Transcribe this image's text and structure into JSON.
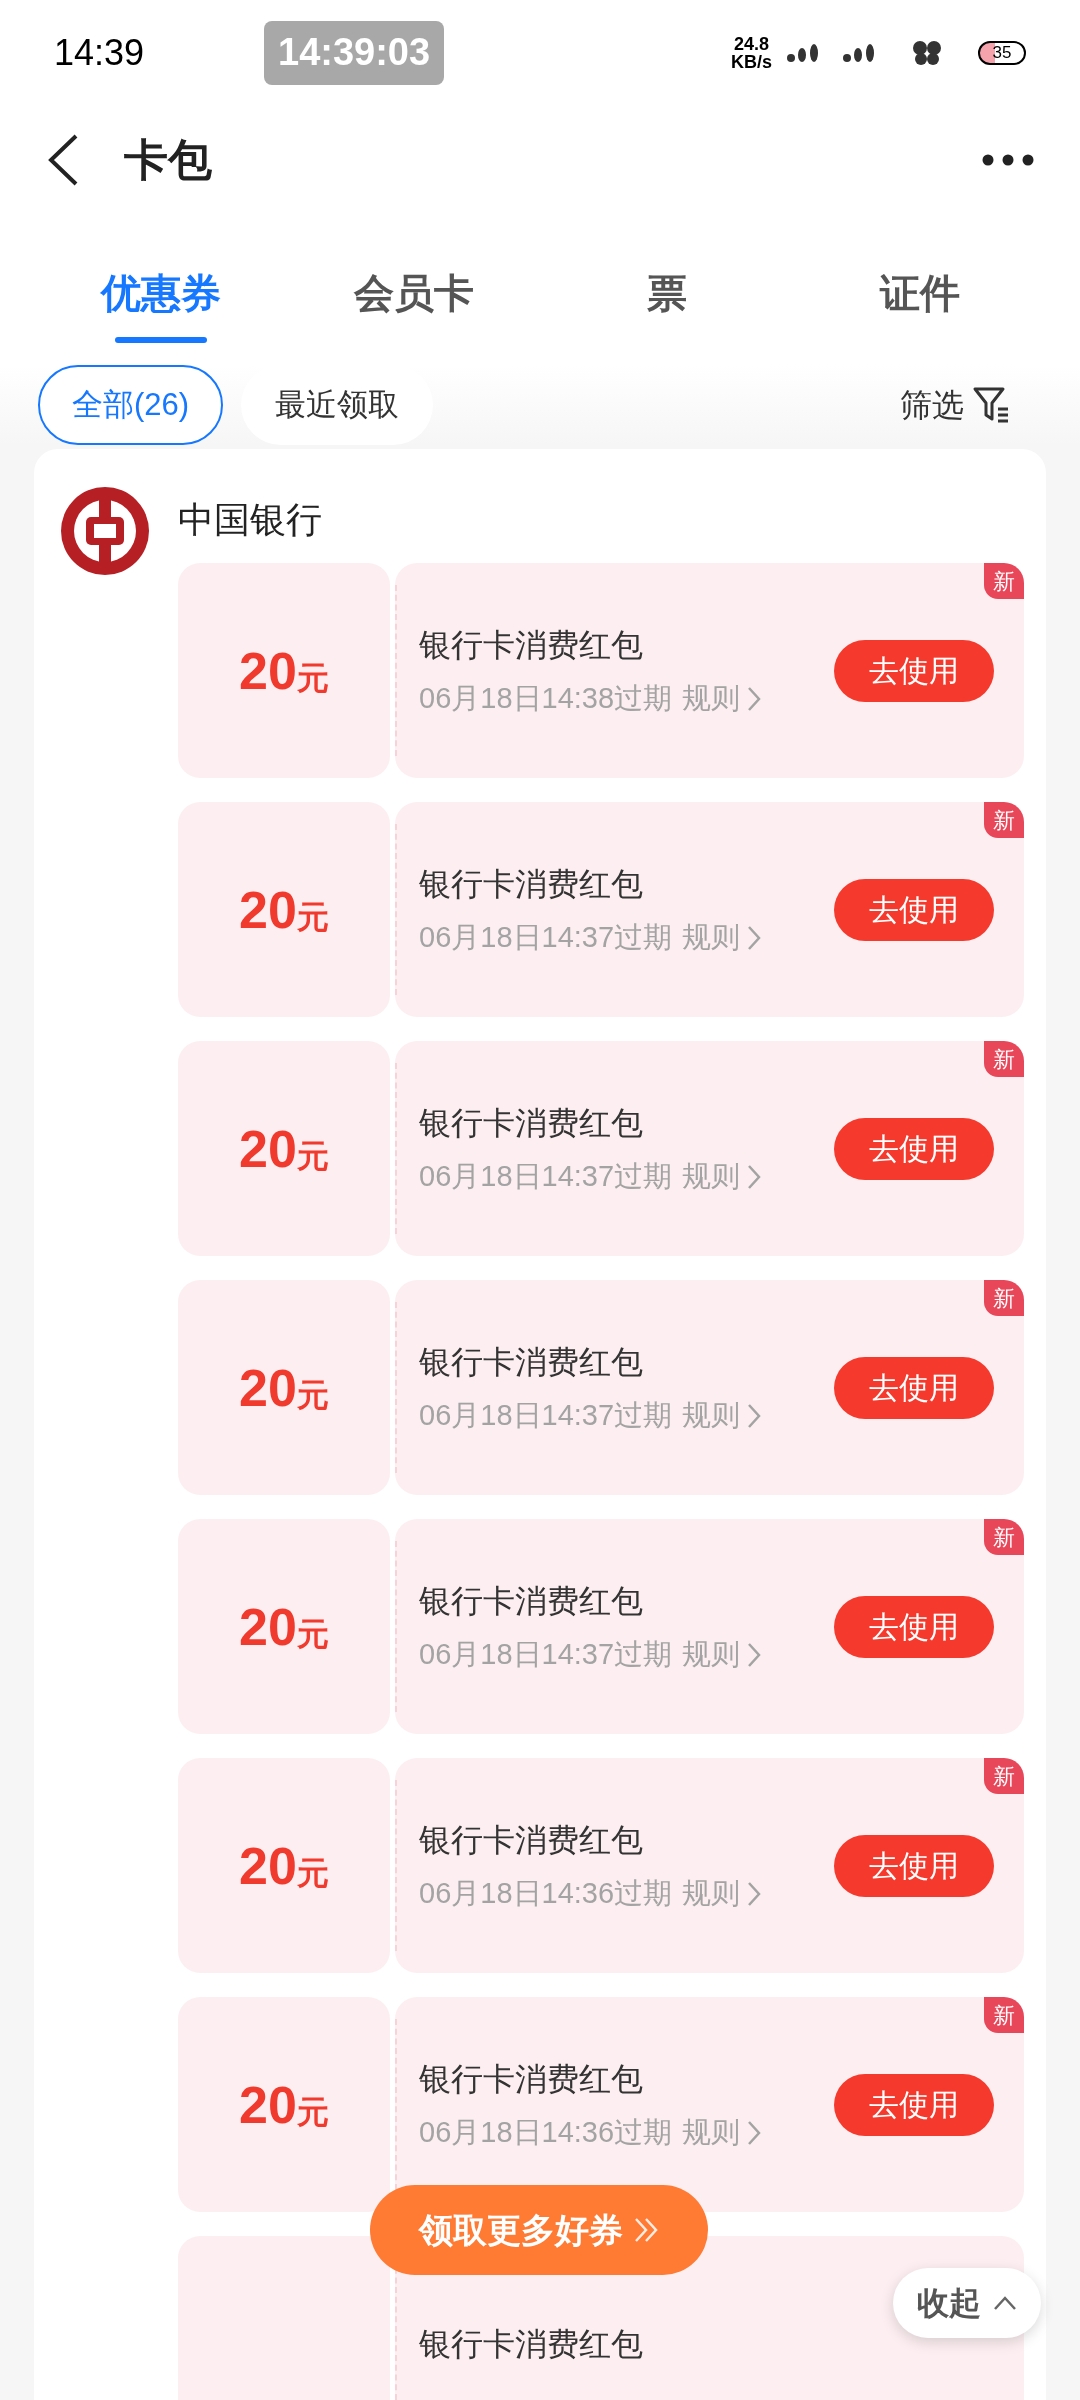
{
  "status_bar": {
    "time": "14:39",
    "recorder_clock": "14:39:03",
    "net_speed": "24.8",
    "net_unit": "KB/s",
    "battery": "35"
  },
  "header": {
    "title": "卡包"
  },
  "tabs": [
    {
      "label": "优惠券",
      "selected": true
    },
    {
      "label": "会员卡",
      "selected": false
    },
    {
      "label": "票",
      "selected": false
    },
    {
      "label": "证件",
      "selected": false
    }
  ],
  "chips": [
    {
      "label": "全部(26)",
      "selected": true
    },
    {
      "label": "最近领取",
      "selected": false
    }
  ],
  "filter": {
    "label": "筛选"
  },
  "bank": {
    "name": "中国银行"
  },
  "coupons": [
    {
      "amount": "20",
      "unit": "元",
      "title": "银行卡消费红包",
      "expiry": "06月18日14:38过期",
      "rule": "规则",
      "button": "去使用",
      "badge": "新"
    },
    {
      "amount": "20",
      "unit": "元",
      "title": "银行卡消费红包",
      "expiry": "06月18日14:37过期",
      "rule": "规则",
      "button": "去使用",
      "badge": "新"
    },
    {
      "amount": "20",
      "unit": "元",
      "title": "银行卡消费红包",
      "expiry": "06月18日14:37过期",
      "rule": "规则",
      "button": "去使用",
      "badge": "新"
    },
    {
      "amount": "20",
      "unit": "元",
      "title": "银行卡消费红包",
      "expiry": "06月18日14:37过期",
      "rule": "规则",
      "button": "去使用",
      "badge": "新"
    },
    {
      "amount": "20",
      "unit": "元",
      "title": "银行卡消费红包",
      "expiry": "06月18日14:37过期",
      "rule": "规则",
      "button": "去使用",
      "badge": "新"
    },
    {
      "amount": "20",
      "unit": "元",
      "title": "银行卡消费红包",
      "expiry": "06月18日14:36过期",
      "rule": "规则",
      "button": "去使用",
      "badge": "新"
    },
    {
      "amount": "20",
      "unit": "元",
      "title": "银行卡消费红包",
      "expiry": "06月18日14:36过期",
      "rule": "规则",
      "button": "去使用",
      "badge": "新"
    },
    {
      "title": "银行卡消费红包"
    }
  ],
  "more_coupons_button": "领取更多好券",
  "collapse_button": "收起"
}
